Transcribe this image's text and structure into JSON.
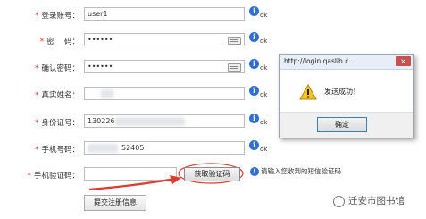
{
  "form": {
    "fields": [
      {
        "label": "登录账号：",
        "value": "user1",
        "ok": "ok"
      },
      {
        "label": "密　 码：",
        "value": "••••••",
        "ok": "ok"
      },
      {
        "label": "确认密码：",
        "value": "••••••",
        "ok": "ok"
      },
      {
        "label": "真实姓名：",
        "value": "",
        "ok": "ok"
      },
      {
        "label": "身份证号：",
        "value": "130226",
        "ok": "ok"
      },
      {
        "label": "手机号码：",
        "value": "52405",
        "ok": "ok"
      },
      {
        "label": "手机验证码：",
        "value": ""
      }
    ],
    "get_code_button": "获取验证码",
    "code_hint": "请输入您收到的短信验证码",
    "submit_button": "提交注册信息"
  },
  "dialog": {
    "title": "http://login.qaslib.c...",
    "close": "×",
    "message": "发送成功！",
    "ok_button": "确定"
  },
  "watermark": "迁安市图书馆",
  "colors": {
    "required_star": "#e0322a",
    "info_icon": "#2f6fd1",
    "arrow": "#e23a2e"
  }
}
